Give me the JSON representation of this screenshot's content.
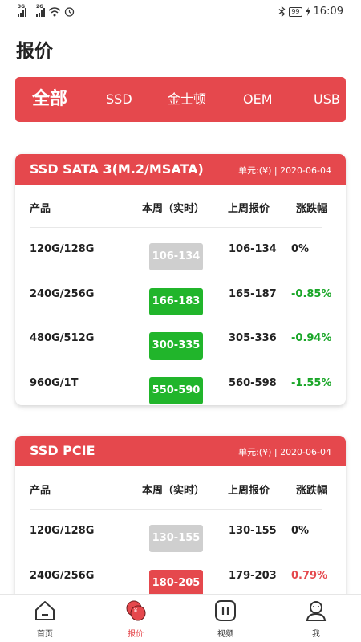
{
  "status_bar": {
    "network_1": "3G",
    "network_2": "2G",
    "battery": "99",
    "time": "16:09"
  },
  "page_title": "报价",
  "categories": [
    {
      "label": "全部",
      "active": true
    },
    {
      "label": "SSD",
      "active": false
    },
    {
      "label": "金士顿",
      "active": false
    },
    {
      "label": "OEM",
      "active": false
    },
    {
      "label": "USB",
      "active": false
    }
  ],
  "columns": {
    "product": "产品",
    "this_week": "本周（实时）",
    "last_week": "上周报价",
    "change": "涨跌幅"
  },
  "cards": [
    {
      "title": "SSD SATA 3(M.2/MSATA)",
      "meta": "单元:(¥) | 2020-06-04",
      "rows": [
        {
          "name": "120G/128G",
          "current": "106-134",
          "last": "106-134",
          "change": "0%",
          "trend": "flat"
        },
        {
          "name": "240G/256G",
          "current": "166-183",
          "last": "165-187",
          "change": "-0.85%",
          "trend": "down"
        },
        {
          "name": "480G/512G",
          "current": "300-335",
          "last": "305-336",
          "change": "-0.94%",
          "trend": "down"
        },
        {
          "name": "960G/1T",
          "current": "550-590",
          "last": "560-598",
          "change": "-1.55%",
          "trend": "down"
        }
      ]
    },
    {
      "title": "SSD PCIE",
      "meta": "单元:(¥) | 2020-06-04",
      "rows": [
        {
          "name": "120G/128G",
          "current": "130-155",
          "last": "130-155",
          "change": "0%",
          "trend": "flat"
        },
        {
          "name": "240G/256G",
          "current": "180-205",
          "last": "179-203",
          "change": "0.79%",
          "trend": "up"
        }
      ]
    }
  ],
  "tabs": [
    {
      "label": "首页",
      "icon": "home-icon",
      "active": false
    },
    {
      "label": "报价",
      "icon": "quote-icon",
      "active": true
    },
    {
      "label": "视频",
      "icon": "video-icon",
      "active": false
    },
    {
      "label": "我",
      "icon": "profile-icon",
      "active": false
    }
  ],
  "colors": {
    "accent": "#e5484d",
    "down": "#21b52b",
    "flat": "#cfcfcf"
  }
}
